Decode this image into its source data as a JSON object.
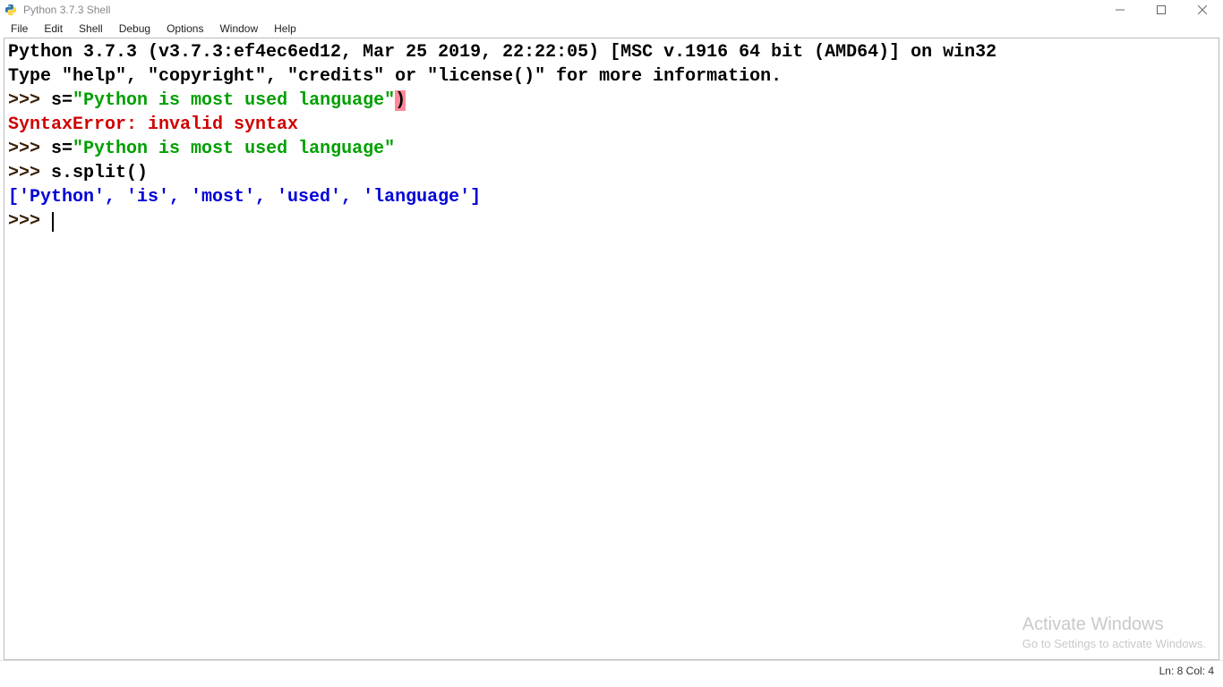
{
  "window": {
    "title": "Python 3.7.3 Shell"
  },
  "menus": {
    "file": "File",
    "edit": "Edit",
    "shell": "Shell",
    "debug": "Debug",
    "options": "Options",
    "window": "Window",
    "help": "Help"
  },
  "shell": {
    "banner1": "Python 3.7.3 (v3.7.3:ef4ec6ed12, Mar 25 2019, 22:22:05) [MSC v.1916 64 bit (AMD64)] on win32",
    "banner2": "Type \"help\", \"copyright\", \"credits\" or \"license()\" for more information.",
    "prompt": ">>> ",
    "line1_code_pre": "s=",
    "line1_str": "\"Python is most used language\"",
    "line1_err_char": ")",
    "error": "SyntaxError: invalid syntax",
    "line2_code_pre": "s=",
    "line2_str": "\"Python is most used language\"",
    "line3_code": "s.split()",
    "output": "['Python', 'is', 'most', 'used', 'language']"
  },
  "watermark": {
    "title": "Activate Windows",
    "sub": "Go to Settings to activate Windows."
  },
  "status": {
    "ln_col": "Ln: 8  Col: 4"
  }
}
